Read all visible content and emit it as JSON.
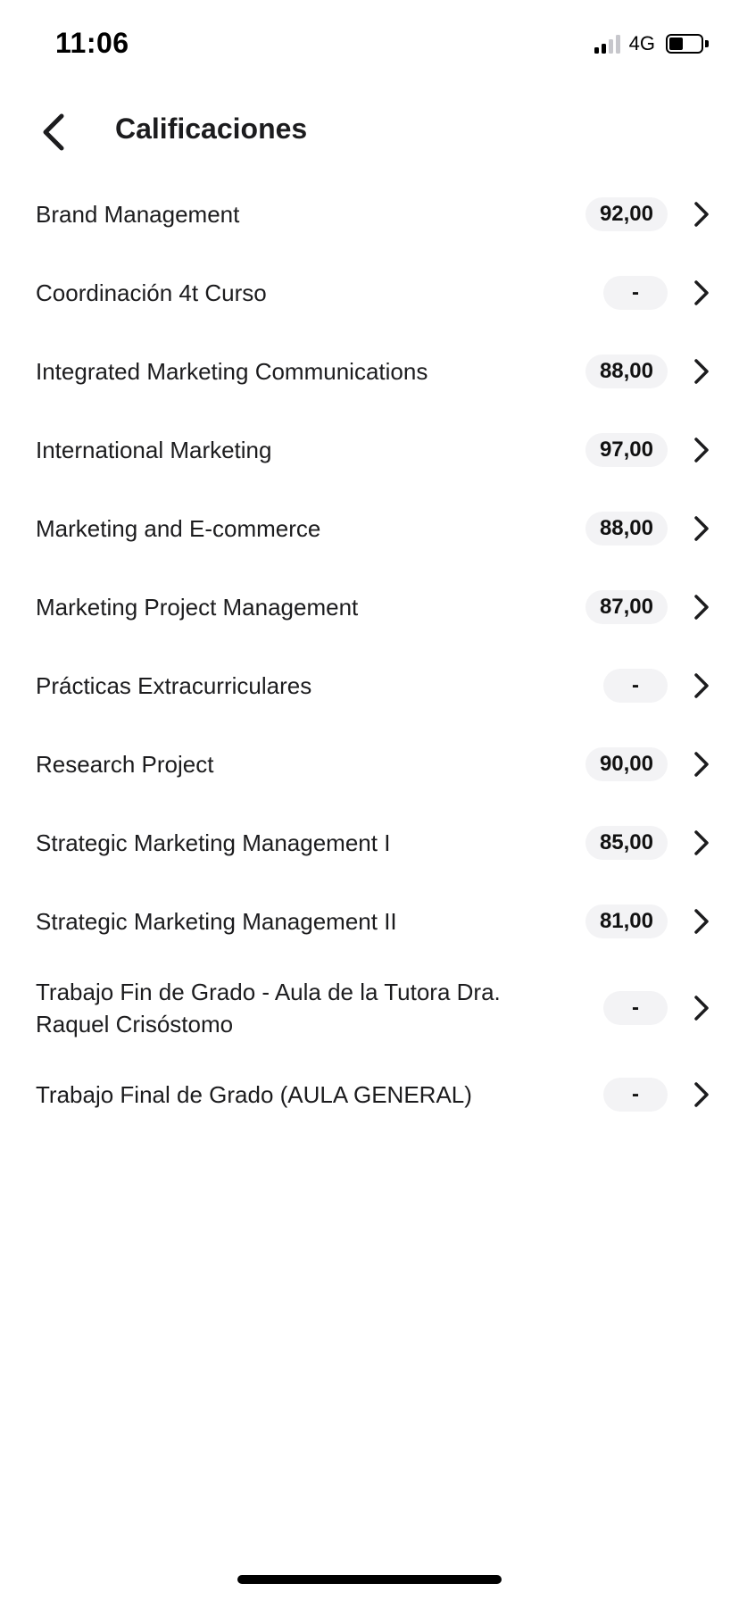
{
  "status_bar": {
    "time": "11:06",
    "network": "4G",
    "signal_bars_active": 2,
    "signal_bars_total": 4,
    "battery_level": 0.45
  },
  "header": {
    "back_icon": "chevron-left-icon",
    "title": "Calificaciones"
  },
  "colors": {
    "text": "#1c1c1e",
    "badge_bg": "#f3f3f5",
    "background": "#ffffff"
  },
  "grades": [
    {
      "course": "Brand Management",
      "grade": "92,00"
    },
    {
      "course": "Coordinación 4t Curso",
      "grade": "-"
    },
    {
      "course": "Integrated Marketing Communications",
      "grade": "88,00"
    },
    {
      "course": "International Marketing",
      "grade": "97,00"
    },
    {
      "course": "Marketing and E-commerce",
      "grade": "88,00"
    },
    {
      "course": "Marketing Project Management",
      "grade": "87,00"
    },
    {
      "course": "Prácticas Extracurriculares",
      "grade": "-"
    },
    {
      "course": "Research Project",
      "grade": "90,00"
    },
    {
      "course": "Strategic Marketing Management I",
      "grade": "85,00"
    },
    {
      "course": "Strategic Marketing Management II",
      "grade": "81,00"
    },
    {
      "course": "Trabajo Fin de Grado - Aula de la Tutora Dra. Raquel Crisóstomo",
      "grade": "-"
    },
    {
      "course": "Trabajo Final de Grado (AULA GENERAL)",
      "grade": "-"
    }
  ]
}
